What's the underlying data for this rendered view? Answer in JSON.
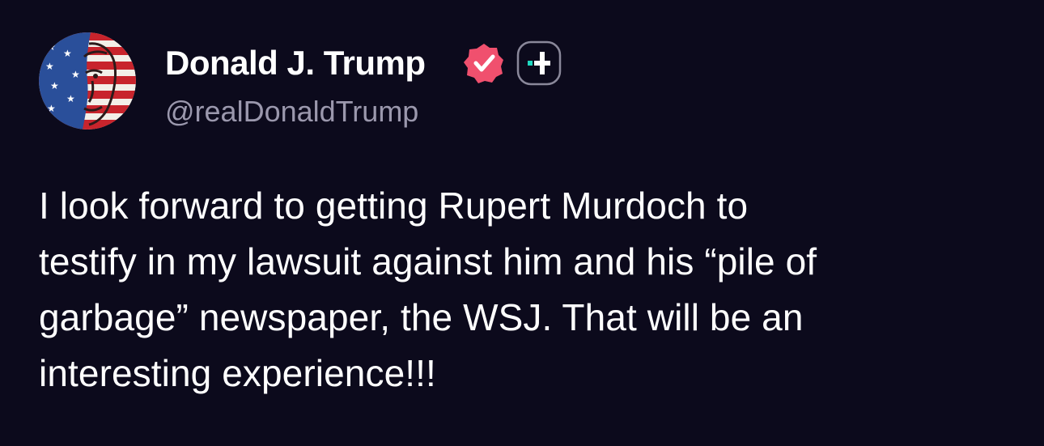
{
  "author": {
    "display_name": "Donald J. Trump",
    "handle": "@realDonaldTrump",
    "avatar_icon": "flag-portrait-avatar",
    "verified_icon": "verified-badge-icon",
    "plus_icon": "plus-badge-icon"
  },
  "post": {
    "lines": [
      "I look forward to getting Rupert Murdoch to",
      "testify in my lawsuit against him and his “pile of",
      "garbage” newspaper, the WSJ. That will be an",
      "interesting experience!!!"
    ]
  },
  "colors": {
    "background": "#0c0a1c",
    "text": "#ffffff",
    "handle": "#9b98ad",
    "verified": "#f0506e",
    "plus_accent": "#1fd8c0"
  }
}
